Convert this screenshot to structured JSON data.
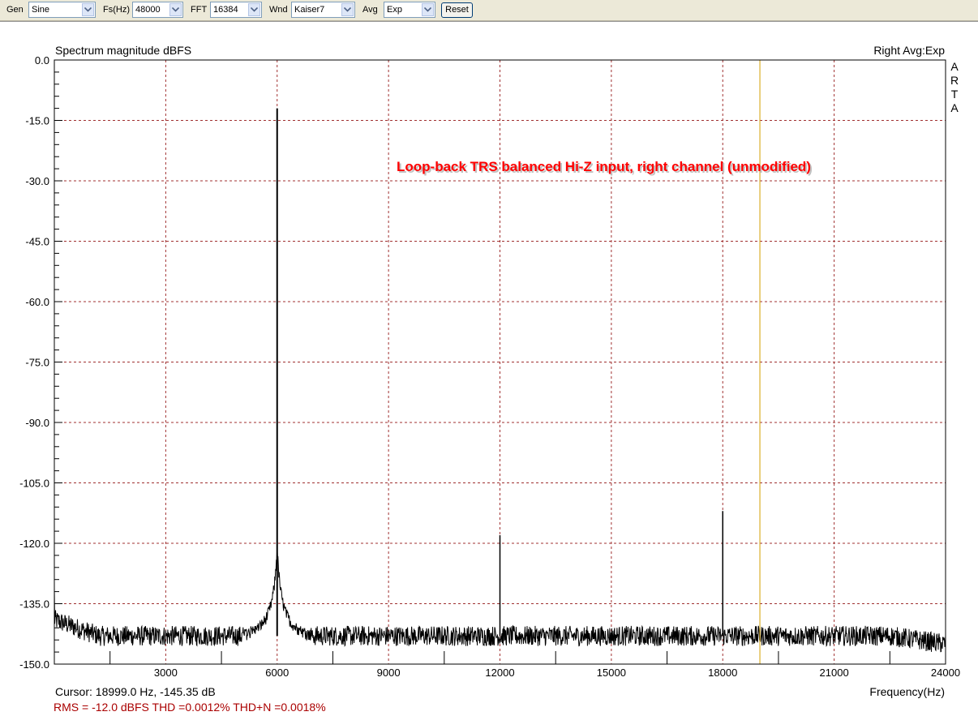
{
  "toolbar": {
    "gen": {
      "label": "Gen",
      "value": "Sine"
    },
    "fs": {
      "label": "Fs(Hz)",
      "value": "48000"
    },
    "fft": {
      "label": "FFT",
      "value": "16384"
    },
    "wnd": {
      "label": "Wnd",
      "value": "Kaiser7"
    },
    "avg": {
      "label": "Avg",
      "value": "Exp"
    },
    "reset_label": "Reset"
  },
  "plot": {
    "channel_info": "Right Avg:Exp",
    "brand_letters": [
      "A",
      "R",
      "T",
      "A"
    ],
    "annotation": "Loop-back TRS balanced Hi-Z input, right channel (unmodified)",
    "cursor_text": "Cursor: 18999.0 Hz, -145.35 dB",
    "stats_text": "RMS =  -12.0 dBFS   THD =0.0012%   THD+N =0.0018%"
  },
  "colors": {
    "grid": "#a03030",
    "trace": "#000000",
    "cursor_line": "#d4a000",
    "annotation": "#ff0000",
    "stats": "#aa0000"
  },
  "chart_data": {
    "type": "line",
    "title": "Spectrum magnitude dBFS",
    "xlabel": "Frequency(Hz)",
    "ylabel": "",
    "xlim": [
      0,
      24000
    ],
    "ylim": [
      -150,
      0
    ],
    "x_ticks": [
      3000,
      6000,
      9000,
      12000,
      15000,
      18000,
      21000,
      24000
    ],
    "y_ticks": [
      "0.0",
      "-15.0",
      "-30.0",
      "-45.0",
      "-60.0",
      "-75.0",
      "-90.0",
      "-105.0",
      "-120.0",
      "-135.0",
      "-150.0"
    ],
    "grid": true,
    "cursor_x": 19000,
    "noise_floor": -143,
    "peaks": [
      {
        "x": 6000,
        "y": -12
      },
      {
        "x": 12000,
        "y": -118
      },
      {
        "x": 18000,
        "y": -112
      }
    ]
  }
}
